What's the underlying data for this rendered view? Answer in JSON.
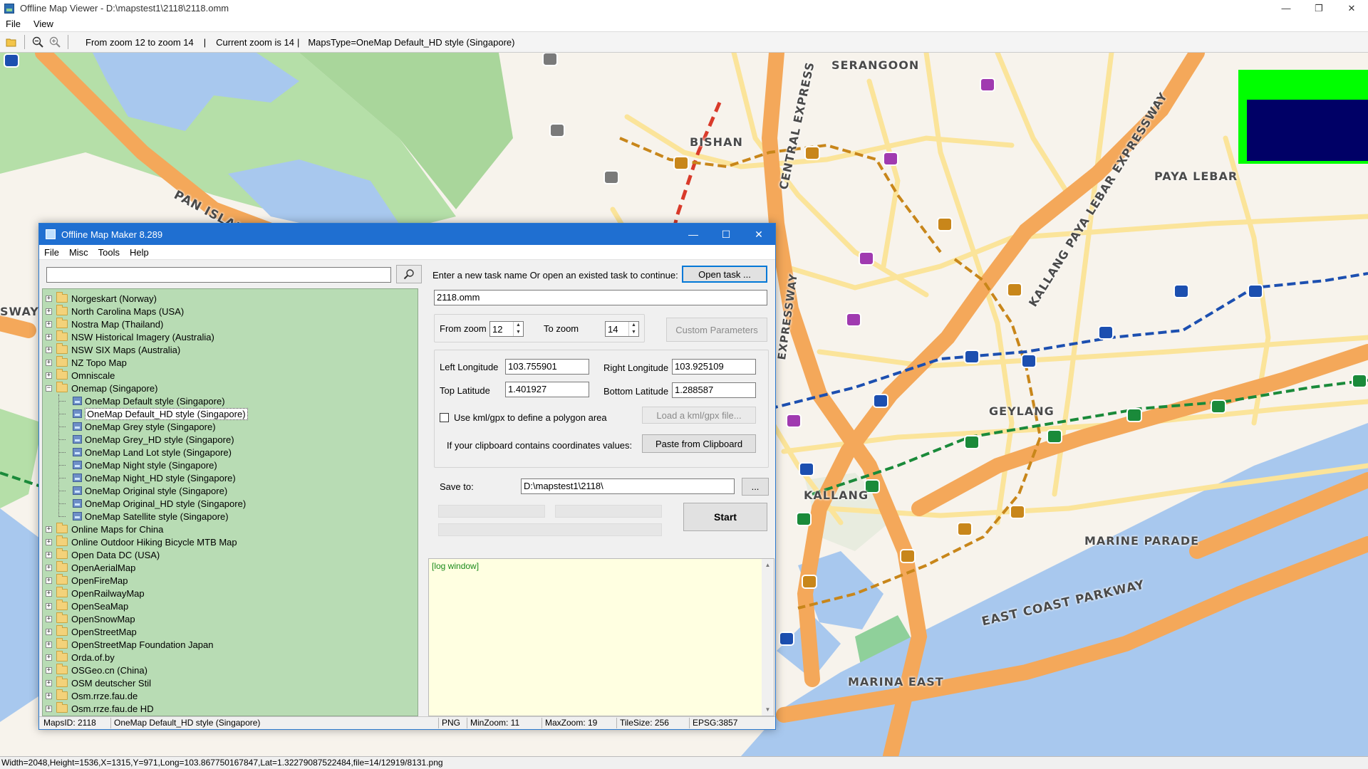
{
  "viewer": {
    "title": "Offline Map Viewer - D:\\mapstest1\\2118\\2118.omm",
    "menu": [
      "File",
      "View"
    ],
    "toolbar": {
      "zoom_range": "From zoom 12 to zoom 14",
      "current_zoom": "Current zoom is 14",
      "maps_type": "MapsType=OneMap Default_HD style (Singapore)",
      "separator": "|"
    },
    "status": "Width=2048,Height=1536,X=1315,Y=971,Long=103.867750167847,Lat=1.32279087522484,file=14/12919/8131.png"
  },
  "map": {
    "labels": [
      "SERANGOON",
      "BISHAN",
      "PAYA LEBAR",
      "PAN ISLAND EXPRESSW",
      "CENTRAL EXPRESS",
      "KALLANG PAYA LEBAR EXPRESSWAY",
      "GEYLANG",
      "KALLANG",
      "MARINE PARADE",
      "EAST COAST PARKWAY",
      "MARINA EAST",
      "SWAY",
      "EXPRESSWAY"
    ],
    "colors": {
      "land": "#f7f3ec",
      "park": "#b5dfa8",
      "water": "#a8c8ee",
      "expressway": "#f4a85a",
      "road": "#fbe49a"
    }
  },
  "maker": {
    "title": "Offline Map Maker 8.289",
    "menu": [
      "File",
      "Misc",
      "Tools",
      "Help"
    ],
    "search": {
      "value": ""
    },
    "tree": {
      "before": [
        "Norgeskart (Norway)",
        "North Carolina Maps (USA)",
        "Nostra Map (Thailand)",
        "NSW Historical Imagery (Australia)",
        "NSW SIX Maps (Australia)",
        "NZ Topo Map",
        "Omniscale"
      ],
      "open_folder": "Onemap (Singapore)",
      "children": [
        "OneMap Default style (Singapore)",
        "OneMap Default_HD style (Singapore)",
        "OneMap Grey style (Singapore)",
        "OneMap Grey_HD style (Singapore)",
        "OneMap Land Lot style (Singapore)",
        "OneMap Night style (Singapore)",
        "OneMap Night_HD style (Singapore)",
        "OneMap Original style (Singapore)",
        "OneMap Original_HD style (Singapore)",
        "OneMap Satellite style (Singapore)"
      ],
      "selected_child": 1,
      "after": [
        "Online Maps for China",
        "Online Outdoor Hiking Bicycle MTB Map",
        "Open Data DC (USA)",
        "OpenAerialMap",
        "OpenFireMap",
        "OpenRailwayMap",
        "OpenSeaMap",
        "OpenSnowMap",
        "OpenStreetMap",
        "OpenStreetMap Foundation Japan",
        "Orda.of.by",
        "OSGeo.cn (China)",
        "OSM deutscher Stil",
        "Osm.rrze.fau.de",
        "Osm.rrze.fau.de HD"
      ]
    },
    "task": {
      "prompt": "Enter a new task name Or open an existed task to continue:",
      "open_button": "Open task ...",
      "name_value": "2118.omm"
    },
    "zoom": {
      "from_label": "From zoom",
      "from_value": "12",
      "to_label": "To zoom",
      "to_value": "14",
      "custom_button": "Custom Parameters"
    },
    "coords": {
      "left_label": "Left Longitude",
      "left_value": "103.755901",
      "right_label": "Right Longitude",
      "right_value": "103.925109",
      "top_label": "Top Latitude",
      "top_value": "1.401927",
      "bottom_label": "Bottom Latitude",
      "bottom_value": "1.288587",
      "kml_label": "Use kml/gpx to define a polygon area",
      "kml_button": "Load a kml/gpx file...",
      "clipboard_label": "If your clipboard contains coordinates values:",
      "clipboard_button": "Paste from Clipboard"
    },
    "save": {
      "label": "Save to:",
      "value": "D:\\mapstest1\\2118\\",
      "browse_button": "...",
      "start_button": "Start"
    },
    "log": {
      "text": "[log window]"
    },
    "status": {
      "maps_id": "MapsID: 2118",
      "map_name": "OneMap Default_HD style (Singapore)",
      "format": "PNG",
      "min_zoom": "MinZoom: 11",
      "max_zoom": "MaxZoom: 19",
      "tile_size": "TileSize: 256",
      "epsg": "EPSG:3857"
    }
  }
}
